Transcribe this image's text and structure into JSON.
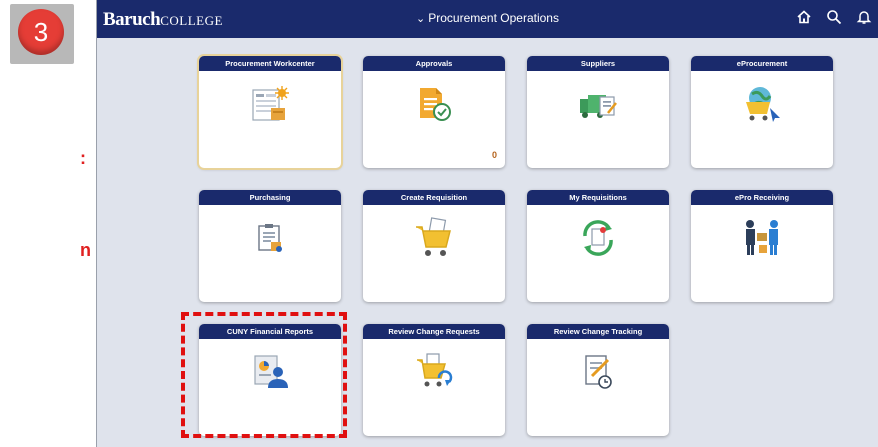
{
  "step": {
    "number": "3"
  },
  "side_fragments": [
    ":",
    "n"
  ],
  "header": {
    "brand_main": "Baruch",
    "brand_sub": "COLLEGE",
    "title": "Procurement Operations",
    "icons": [
      "home-icon",
      "search-icon",
      "bell-icon"
    ]
  },
  "tiles": [
    {
      "label": "Procurement Workcenter",
      "icon": "workcenter-icon"
    },
    {
      "label": "Approvals",
      "icon": "approvals-icon",
      "count": "0"
    },
    {
      "label": "Suppliers",
      "icon": "suppliers-icon"
    },
    {
      "label": "eProcurement",
      "icon": "eprocurement-icon"
    },
    {
      "label": "Purchasing",
      "icon": "purchasing-icon"
    },
    {
      "label": "Create Requisition",
      "icon": "cart-icon"
    },
    {
      "label": "My Requisitions",
      "icon": "requisitions-icon"
    },
    {
      "label": "ePro Receiving",
      "icon": "receiving-icon"
    },
    {
      "label": "CUNY Financial Reports",
      "icon": "reports-icon"
    },
    {
      "label": "Review Change Requests",
      "icon": "change-requests-icon"
    },
    {
      "label": "Review Change Tracking",
      "icon": "change-tracking-icon"
    }
  ],
  "colors": {
    "banner": "#1a2a6c",
    "highlight": "#e01010",
    "badge": "#e53d36"
  }
}
